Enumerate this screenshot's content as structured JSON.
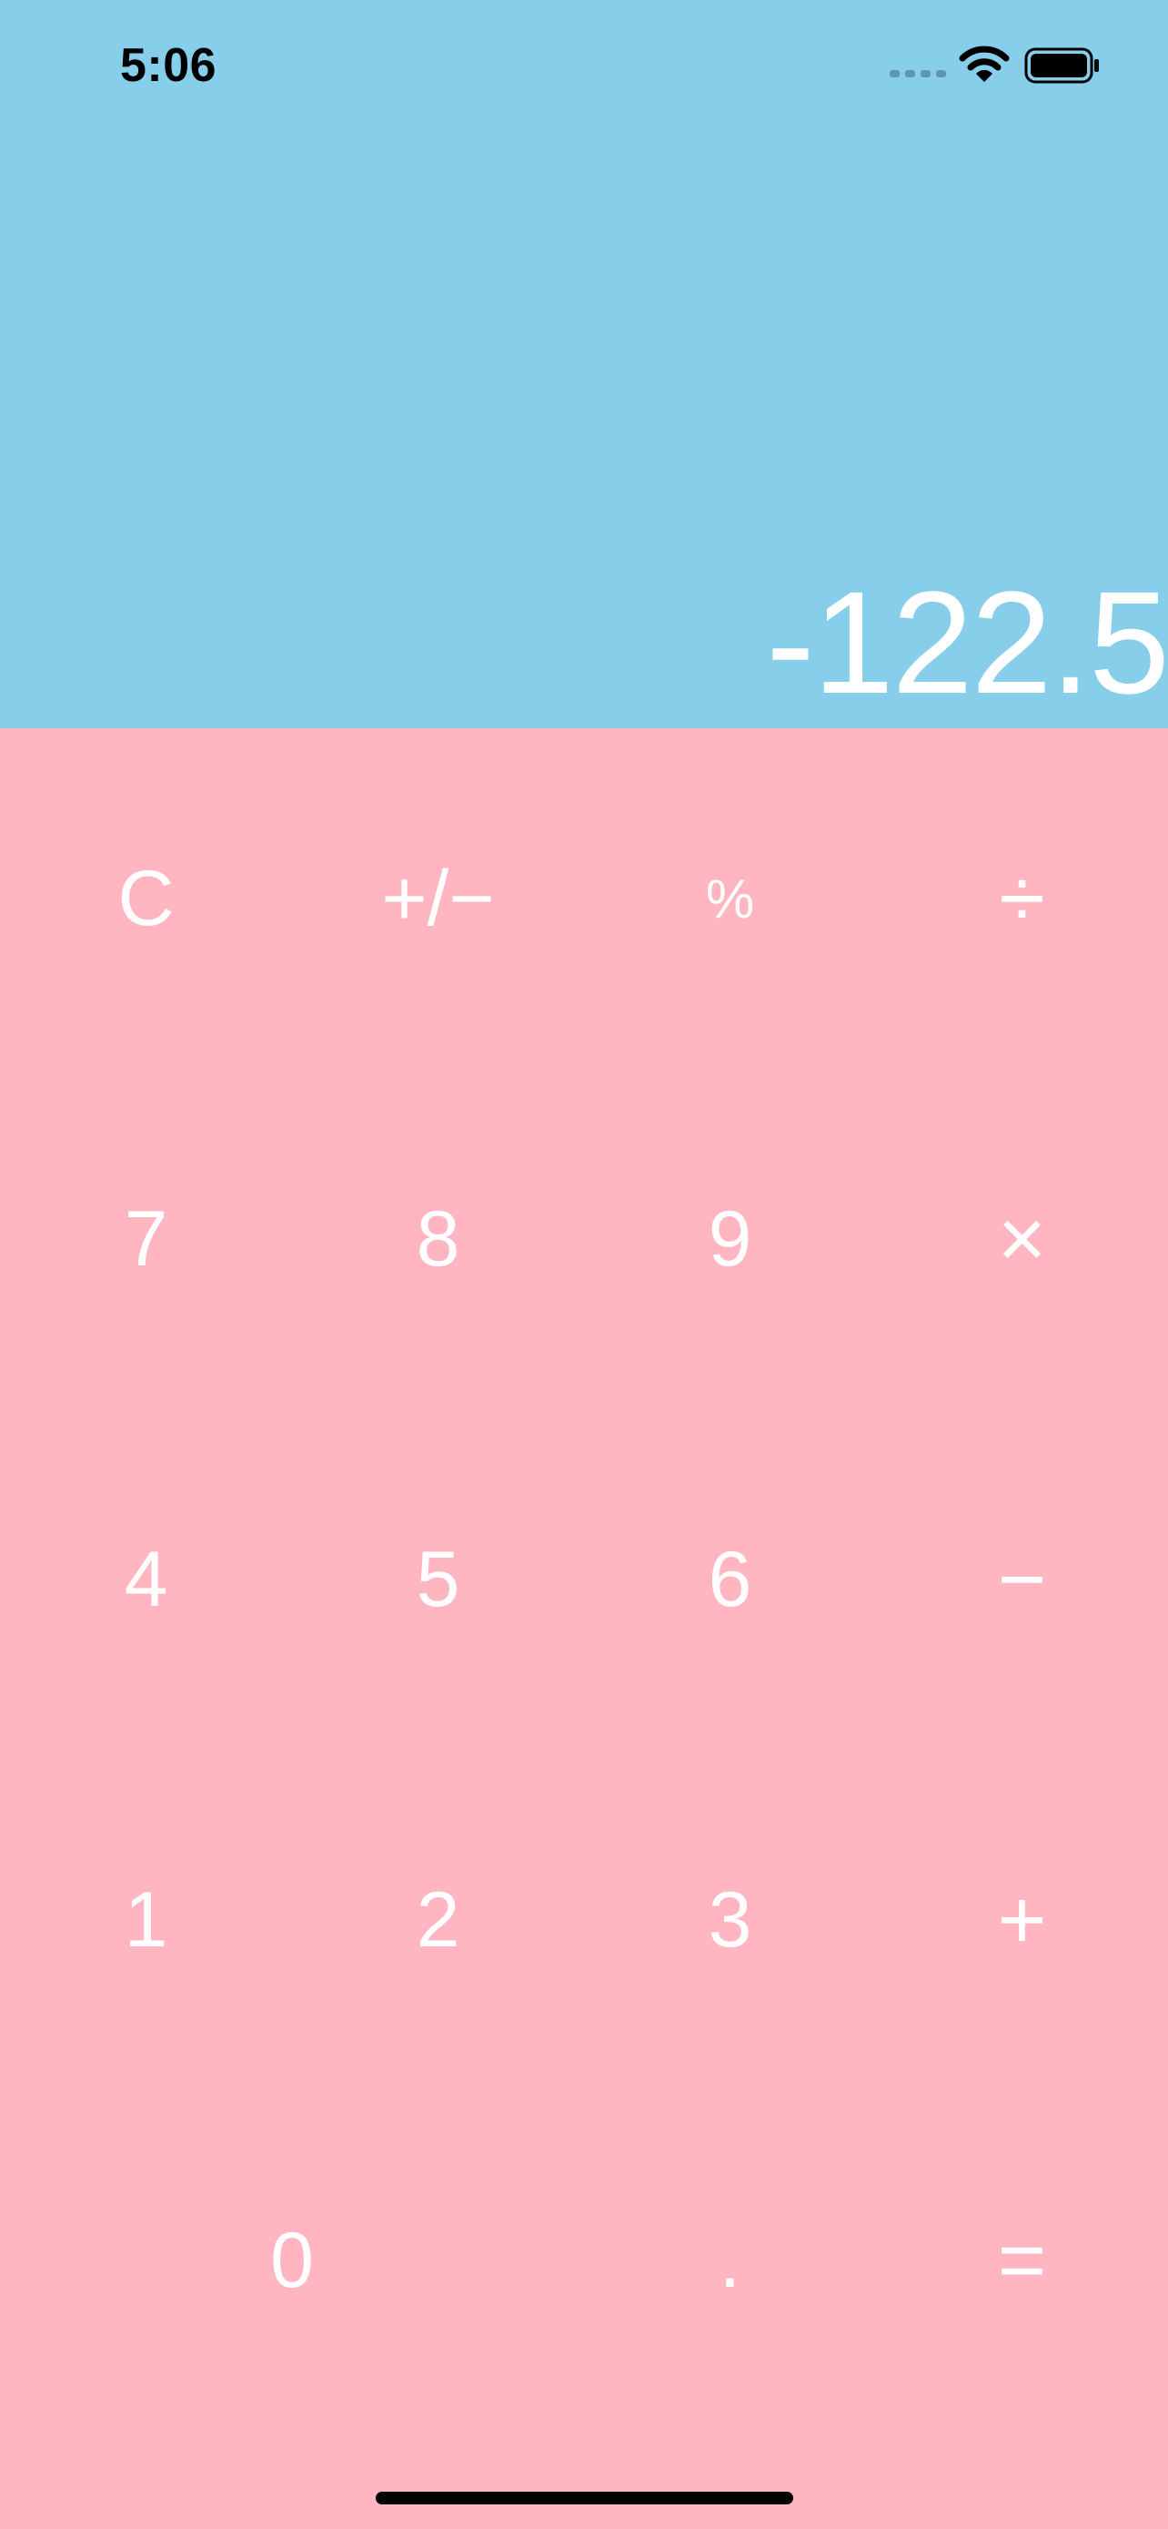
{
  "status_bar": {
    "time": "5:06",
    "icons": [
      "cellular-signal-icon",
      "wifi-icon",
      "battery-icon"
    ]
  },
  "display": {
    "value": "-122.5"
  },
  "keypad": {
    "rows": [
      [
        {
          "label": "C",
          "name": "clear-button"
        },
        {
          "label": "+/−",
          "name": "plus-minus-button"
        },
        {
          "label": "%",
          "name": "percent-button"
        },
        {
          "label": "÷",
          "name": "divide-button"
        }
      ],
      [
        {
          "label": "7",
          "name": "digit-7-button"
        },
        {
          "label": "8",
          "name": "digit-8-button"
        },
        {
          "label": "9",
          "name": "digit-9-button"
        },
        {
          "label": "×",
          "name": "multiply-button"
        }
      ],
      [
        {
          "label": "4",
          "name": "digit-4-button"
        },
        {
          "label": "5",
          "name": "digit-5-button"
        },
        {
          "label": "6",
          "name": "digit-6-button"
        },
        {
          "label": "−",
          "name": "subtract-button"
        }
      ],
      [
        {
          "label": "1",
          "name": "digit-1-button"
        },
        {
          "label": "2",
          "name": "digit-2-button"
        },
        {
          "label": "3",
          "name": "digit-3-button"
        },
        {
          "label": "+",
          "name": "add-button"
        }
      ],
      [
        {
          "label": "0",
          "name": "digit-0-button"
        },
        {
          "label": ".",
          "name": "decimal-button"
        },
        {
          "label": "=",
          "name": "equals-button"
        }
      ]
    ]
  },
  "colors": {
    "display_background": "#87CEEB",
    "keypad_background": "#FFB6C1",
    "text": "#FFFFFF"
  }
}
